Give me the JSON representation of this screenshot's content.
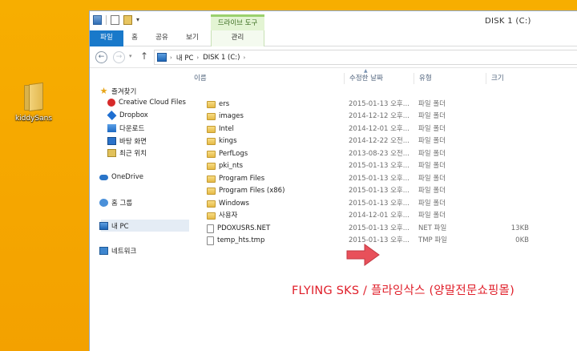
{
  "desktop": {
    "icon_label": "kiddySans"
  },
  "window": {
    "title": "DISK 1 (C:)",
    "context_tab_group": "드라이브 도구"
  },
  "ribbon": {
    "tabs": [
      "파일",
      "홈",
      "공유",
      "보기",
      "관리"
    ]
  },
  "address_bar": {
    "crumbs": [
      "내 PC",
      "DISK 1 (C:)"
    ]
  },
  "nav_pane": {
    "favorites": "즐겨찾기",
    "favorite_items": [
      "Creative Cloud Files",
      "Dropbox",
      "다운로드",
      "바탕 화면",
      "최근 위치"
    ],
    "onedrive": "OneDrive",
    "homegroup": "홈 그룹",
    "this_pc": "내 PC",
    "network": "네트워크"
  },
  "file_list": {
    "columns": [
      "이름",
      "수정한 날짜",
      "유형",
      "크기"
    ],
    "rows": [
      {
        "name": "ers",
        "date": "2015-01-13 오후...",
        "type": "파일 폴더",
        "size": "",
        "kind": "folder"
      },
      {
        "name": "images",
        "date": "2014-12-12 오후...",
        "type": "파일 폴더",
        "size": "",
        "kind": "folder"
      },
      {
        "name": "Intel",
        "date": "2014-12-01 오후...",
        "type": "파일 폴더",
        "size": "",
        "kind": "folder"
      },
      {
        "name": "kings",
        "date": "2014-12-22 오전...",
        "type": "파일 폴더",
        "size": "",
        "kind": "folder"
      },
      {
        "name": "PerfLogs",
        "date": "2013-08-23 오전...",
        "type": "파일 폴더",
        "size": "",
        "kind": "folder"
      },
      {
        "name": "pki_nts",
        "date": "2015-01-13 오후...",
        "type": "파일 폴더",
        "size": "",
        "kind": "folder"
      },
      {
        "name": "Program Files",
        "date": "2015-01-13 오후...",
        "type": "파일 폴더",
        "size": "",
        "kind": "folder"
      },
      {
        "name": "Program Files (x86)",
        "date": "2015-01-13 오후...",
        "type": "파일 폴더",
        "size": "",
        "kind": "folder"
      },
      {
        "name": "Windows",
        "date": "2015-01-13 오후...",
        "type": "파일 폴더",
        "size": "",
        "kind": "folder"
      },
      {
        "name": "사용자",
        "date": "2014-12-01 오후...",
        "type": "파일 폴더",
        "size": "",
        "kind": "folder"
      },
      {
        "name": "PDOXUSRS.NET",
        "date": "2015-01-13 오후...",
        "type": "NET 파일",
        "size": "13KB",
        "kind": "file"
      },
      {
        "name": "temp_hts.tmp",
        "date": "2015-01-13 오후...",
        "type": "TMP 파일",
        "size": "0KB",
        "kind": "file"
      }
    ]
  },
  "annotation": {
    "caption": "FLYING SKS / 플라잉삭스 (양말전문쇼핑몰)",
    "arrow_color": "#e8505a",
    "caption_color": "#e0202b"
  },
  "colors": {
    "desktop": "#f5a800",
    "file_tab": "#1979ca",
    "context_tab": "#9ad06e"
  }
}
